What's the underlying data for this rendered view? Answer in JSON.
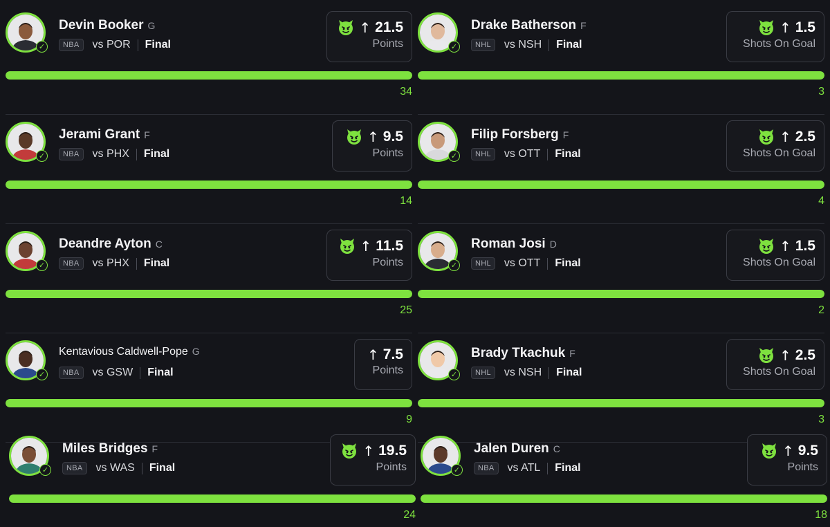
{
  "colors": {
    "accent": "#7ee13f",
    "background": "#14151a",
    "card_border": "#3a3c44"
  },
  "picks": [
    {
      "name": "Devin Booker",
      "position": "G",
      "league": "NBA",
      "opponent": "vs POR",
      "status": "Final",
      "line": "21.5",
      "direction": "↑",
      "stat": "Points",
      "actual": "34",
      "devil": true,
      "progress": 1.0
    },
    {
      "name": "Drake Batherson",
      "position": "F",
      "league": "NHL",
      "opponent": "vs NSH",
      "status": "Final",
      "line": "1.5",
      "direction": "↑",
      "stat": "Shots On Goal",
      "actual": "3",
      "devil": true,
      "progress": 1.0
    },
    {
      "name": "Jerami Grant",
      "position": "F",
      "league": "NBA",
      "opponent": "vs PHX",
      "status": "Final",
      "line": "9.5",
      "direction": "↑",
      "stat": "Points",
      "actual": "14",
      "devil": true,
      "progress": 1.0
    },
    {
      "name": "Filip Forsberg",
      "position": "F",
      "league": "NHL",
      "opponent": "vs OTT",
      "status": "Final",
      "line": "2.5",
      "direction": "↑",
      "stat": "Shots On Goal",
      "actual": "4",
      "devil": true,
      "progress": 1.0
    },
    {
      "name": "Deandre Ayton",
      "position": "C",
      "league": "NBA",
      "opponent": "vs PHX",
      "status": "Final",
      "line": "11.5",
      "direction": "↑",
      "stat": "Points",
      "actual": "25",
      "devil": true,
      "progress": 1.0
    },
    {
      "name": "Roman Josi",
      "position": "D",
      "league": "NHL",
      "opponent": "vs OTT",
      "status": "Final",
      "line": "1.5",
      "direction": "↑",
      "stat": "Shots On Goal",
      "actual": "2",
      "devil": true,
      "progress": 1.0
    },
    {
      "name": "Kentavious Caldwell-Pope",
      "position": "G",
      "league": "NBA",
      "opponent": "vs GSW",
      "status": "Final",
      "line": "7.5",
      "direction": "↑",
      "stat": "Points",
      "actual": "9",
      "devil": false,
      "progress": 1.0
    },
    {
      "name": "Brady Tkachuk",
      "position": "F",
      "league": "NHL",
      "opponent": "vs NSH",
      "status": "Final",
      "line": "2.5",
      "direction": "↑",
      "stat": "Shots On Goal",
      "actual": "3",
      "devil": true,
      "progress": 1.0
    },
    {
      "name": "Miles Bridges",
      "position": "F",
      "league": "NBA",
      "opponent": "vs WAS",
      "status": "Final",
      "line": "19.5",
      "direction": "↑",
      "stat": "Points",
      "actual": "24",
      "devil": true,
      "progress": 1.0
    },
    {
      "name": "Jalen Duren",
      "position": "C",
      "league": "NBA",
      "opponent": "vs ATL",
      "status": "Final",
      "line": "9.5",
      "direction": "↑",
      "stat": "Points",
      "actual": "18",
      "devil": true,
      "progress": 1.0
    }
  ]
}
